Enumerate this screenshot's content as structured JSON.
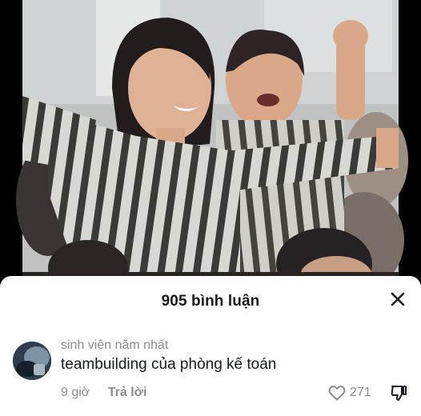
{
  "video": {
    "description_icon": "video-frame"
  },
  "comments_sheet": {
    "title": "905 bình luận",
    "close_icon": "close-icon"
  },
  "comment": {
    "username": "sinh viên năm nhất",
    "text": "teambuilding của phòng kế toán",
    "time": "9 giờ",
    "reply_label": "Trả lời",
    "like_count": "271",
    "like_icon": "heart-outline-icon",
    "dislike_icon": "thumbs-down-icon"
  }
}
